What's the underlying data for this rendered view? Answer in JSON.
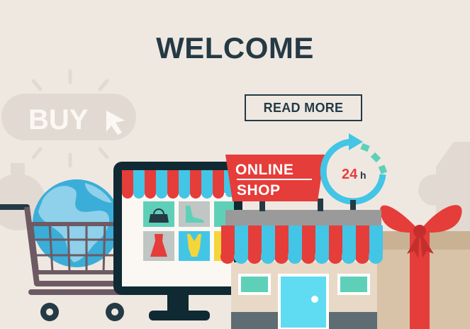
{
  "header": {
    "title": "WELCOME"
  },
  "cta": {
    "read_more_label": "READ MORE"
  },
  "illustration": {
    "buy_label": "BUY",
    "sign_line1": "ONLINE",
    "sign_line2": "SHOP",
    "hours_number": "24",
    "hours_unit": "h"
  },
  "colors": {
    "background": "#efe8e1",
    "text_dark": "#243a45",
    "accent_red": "#e53d3a",
    "accent_blue": "#43c5e6",
    "accent_teal": "#5fd0b8"
  }
}
